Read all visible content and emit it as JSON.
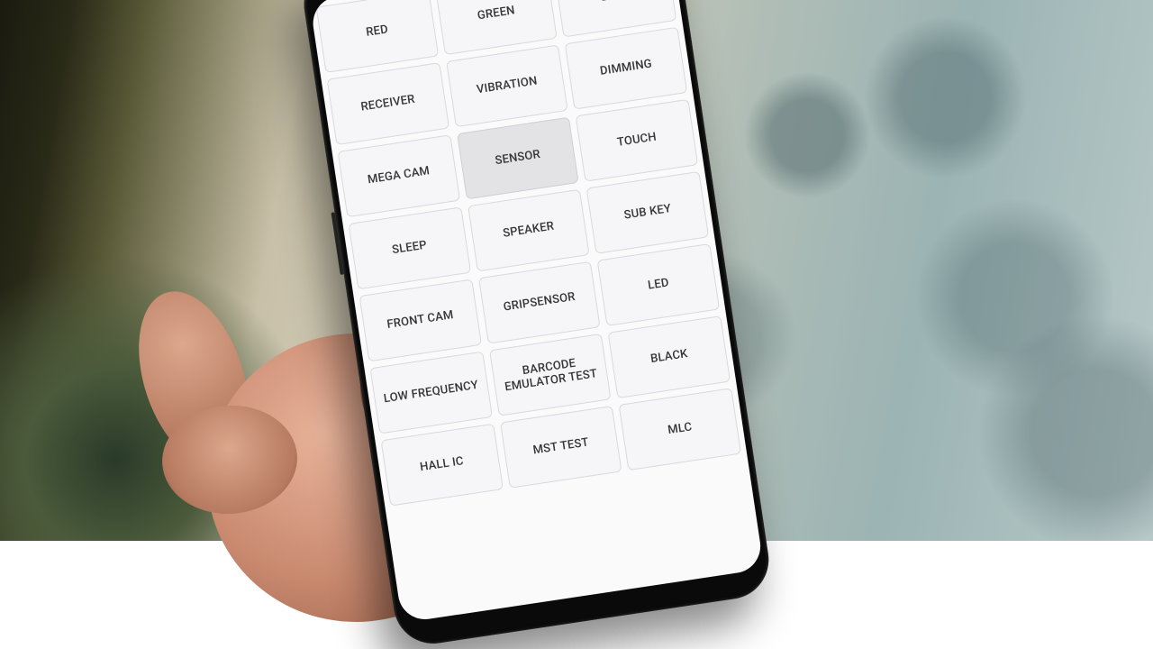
{
  "device": "samsung-galaxy-s8",
  "screen": "hw-module-test",
  "buttons": [
    {
      "id": "red",
      "label": "RED",
      "pressed": false
    },
    {
      "id": "green",
      "label": "GREEN",
      "pressed": false
    },
    {
      "id": "blue",
      "label": "BLUE",
      "pressed": false
    },
    {
      "id": "receiver",
      "label": "RECEIVER",
      "pressed": false
    },
    {
      "id": "vibration",
      "label": "VIBRATION",
      "pressed": false
    },
    {
      "id": "dimming",
      "label": "DIMMING",
      "pressed": false
    },
    {
      "id": "mega-cam",
      "label": "MEGA CAM",
      "pressed": false
    },
    {
      "id": "sensor",
      "label": "SENSOR",
      "pressed": true
    },
    {
      "id": "touch",
      "label": "TOUCH",
      "pressed": false
    },
    {
      "id": "sleep",
      "label": "SLEEP",
      "pressed": false
    },
    {
      "id": "speaker",
      "label": "SPEAKER",
      "pressed": false
    },
    {
      "id": "sub-key",
      "label": "SUB KEY",
      "pressed": false
    },
    {
      "id": "front-cam",
      "label": "FRONT CAM",
      "pressed": false
    },
    {
      "id": "gripsensor",
      "label": "GRIPSENSOR",
      "pressed": false
    },
    {
      "id": "led",
      "label": "LED",
      "pressed": false
    },
    {
      "id": "low-frequency",
      "label": "LOW FREQUENCY",
      "pressed": false
    },
    {
      "id": "barcode-emulator-test",
      "label": "BARCODE EMULATOR TEST",
      "pressed": false
    },
    {
      "id": "black",
      "label": "BLACK",
      "pressed": false
    },
    {
      "id": "hall-ic",
      "label": "HALL IC",
      "pressed": false
    },
    {
      "id": "mst-test",
      "label": "MST TEST",
      "pressed": false
    },
    {
      "id": "mlc",
      "label": "MLC",
      "pressed": false
    }
  ]
}
